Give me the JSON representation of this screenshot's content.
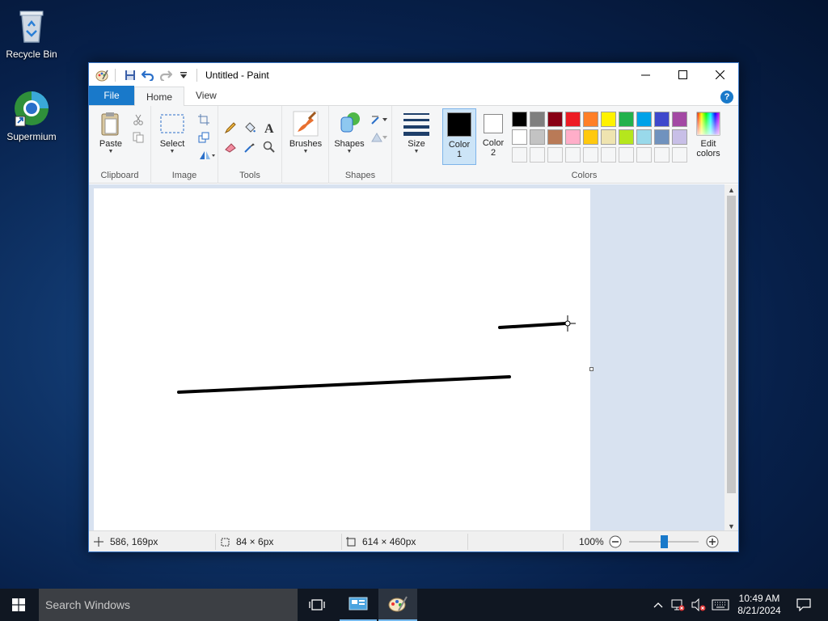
{
  "desktop": {
    "icons": [
      {
        "label": "Recycle Bin",
        "icon": "recycle-bin-icon"
      },
      {
        "label": "Supermium",
        "icon": "supermium-browser-icon"
      }
    ]
  },
  "window": {
    "title": "Untitled - Paint",
    "controls": {
      "minimize": "minimize-icon",
      "maximize": "maximize-icon",
      "close": "close-icon"
    }
  },
  "tabs": [
    "File",
    "Home",
    "View"
  ],
  "ribbon": {
    "clipboard": {
      "label": "Clipboard",
      "paste": "Paste"
    },
    "image": {
      "label": "Image",
      "select": "Select"
    },
    "tools": {
      "label": "Tools"
    },
    "brushes": {
      "label": "Brushes"
    },
    "shapes": {
      "label": "Shapes",
      "shapes": "Shapes"
    },
    "size": {
      "label": "Size"
    },
    "colors": {
      "label": "Colors",
      "color1": "Color",
      "color1_num": "1",
      "color2": "Color",
      "color2_num": "2",
      "edit_colors_1": "Edit",
      "edit_colors_2": "colors",
      "row1": [
        "#000000",
        "#7f7f7f",
        "#880015",
        "#ed1c24",
        "#ff7f27",
        "#fff200",
        "#22b14c",
        "#00a2e8",
        "#3f48cc",
        "#a349a4"
      ],
      "row2": [
        "#ffffff",
        "#c3c3c3",
        "#b97a57",
        "#ffaec9",
        "#ffc90e",
        "#efe4b0",
        "#b5e61d",
        "#99d9ea",
        "#7092be",
        "#c8bfe7"
      ]
    }
  },
  "status": {
    "cursor_pos": "586, 169px",
    "selection_size": "84 × 6px",
    "image_size": "614 × 460px",
    "zoom": "100%",
    "zoom_level": 0.5
  },
  "taskbar": {
    "search_placeholder": "Search Windows",
    "time": "10:49 AM",
    "date": "8/21/2024"
  }
}
